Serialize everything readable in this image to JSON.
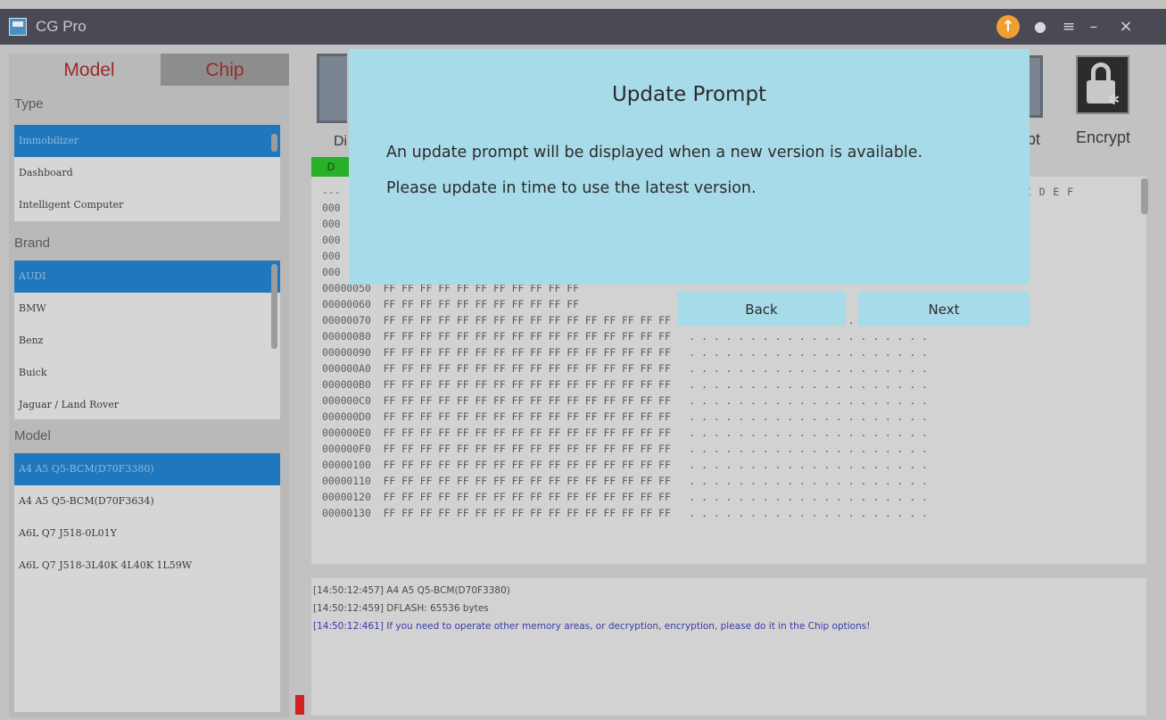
{
  "window": {
    "title": "CG Pro"
  },
  "titlebar": {
    "update_glyph": "↑",
    "user_glyph": "●",
    "menu_glyph": "≡",
    "minimize_glyph": "–",
    "close_glyph": "×"
  },
  "left_panel": {
    "tabs": [
      {
        "label": "Model"
      },
      {
        "label": "Chip"
      }
    ],
    "type": {
      "title": "Type",
      "items": [
        {
          "label": "Immobilizer",
          "selected": true
        },
        {
          "label": "Dashboard",
          "selected": false
        },
        {
          "label": "Intelligent Computer",
          "selected": false
        }
      ]
    },
    "brand": {
      "title": "Brand",
      "items": [
        {
          "label": "AUDI",
          "selected": true
        },
        {
          "label": "BMW",
          "selected": false
        },
        {
          "label": "Benz",
          "selected": false
        },
        {
          "label": "Buick",
          "selected": false
        },
        {
          "label": "Jaguar / Land Rover",
          "selected": false
        }
      ]
    },
    "model": {
      "title": "Model",
      "items": [
        {
          "label": "A4 A5 Q5-BCM(D70F3380)",
          "selected": true
        },
        {
          "label": "A4 A5 Q5-BCM(D70F3634)",
          "selected": false
        },
        {
          "label": "A6L Q7 J518-0L01Y",
          "selected": false
        },
        {
          "label": "A6L Q7 J518-3L40K 4L40K 1L59W",
          "selected": false
        }
      ]
    }
  },
  "toolbar": {
    "left_label_partial": "Di",
    "green_bar_label": "D",
    "decrypt_label_partial": "pt",
    "encrypt_label": "Encrypt"
  },
  "hex": {
    "header": "C D E F",
    "rows": [
      "---",
      "000",
      "000",
      "000",
      "000",
      "000",
      "00000050  FF FF FF FF FF FF FF FF FF FF FF",
      "00000060  FF FF FF FF FF FF FF FF FF FF FF",
      "00000070  FF FF FF FF FF FF FF FF FF FF FF FF FF FF FF FF   . . . . . . . . . . . . . . . . . . . .",
      "00000080  FF FF FF FF FF FF FF FF FF FF FF FF FF FF FF FF   . . . . . . . . . . . . . . . . . . . .",
      "00000090  FF FF FF FF FF FF FF FF FF FF FF FF FF FF FF FF   . . . . . . . . . . . . . . . . . . . .",
      "000000A0  FF FF FF FF FF FF FF FF FF FF FF FF FF FF FF FF   . . . . . . . . . . . . . . . . . . . .",
      "000000B0  FF FF FF FF FF FF FF FF FF FF FF FF FF FF FF FF   . . . . . . . . . . . . . . . . . . . .",
      "000000C0  FF FF FF FF FF FF FF FF FF FF FF FF FF FF FF FF   . . . . . . . . . . . . . . . . . . . .",
      "000000D0  FF FF FF FF FF FF FF FF FF FF FF FF FF FF FF FF   . . . . . . . . . . . . . . . . . . . .",
      "000000E0  FF FF FF FF FF FF FF FF FF FF FF FF FF FF FF FF   . . . . . . . . . . . . . . . . . . . .",
      "000000F0  FF FF FF FF FF FF FF FF FF FF FF FF FF FF FF FF   . . . . . . . . . . . . . . . . . . . .",
      "00000100  FF FF FF FF FF FF FF FF FF FF FF FF FF FF FF FF   . . . . . . . . . . . . . . . . . . . .",
      "00000110  FF FF FF FF FF FF FF FF FF FF FF FF FF FF FF FF   . . . . . . . . . . . . . . . . . . . .",
      "00000120  FF FF FF FF FF FF FF FF FF FF FF FF FF FF FF FF   . . . . . . . . . . . . . . . . . . . .",
      "00000130  FF FF FF FF FF FF FF FF FF FF FF FF FF FF FF FF   . . . . . . . . . . . . . . . . . . . ."
    ],
    "right_dots": ". . . ."
  },
  "log": [
    {
      "time": "[14:50:12:457]",
      "text": "A4  A5  Q5-BCM(D70F3380)",
      "kind": "normal"
    },
    {
      "time": "[14:50:12:459]",
      "text": "DFLASH:  65536  bytes",
      "kind": "normal"
    },
    {
      "time": "[14:50:12:461]",
      "text": "If you need to operate other memory areas, or decryption, encryption, please do it in the Chip options!",
      "kind": "info"
    }
  ],
  "modal": {
    "title": "Update Prompt",
    "line1": "An update prompt will be displayed when a new version is available.",
    "line2": "Please update in time to use the latest version.",
    "back_label": "Back",
    "next_label": "Next"
  }
}
